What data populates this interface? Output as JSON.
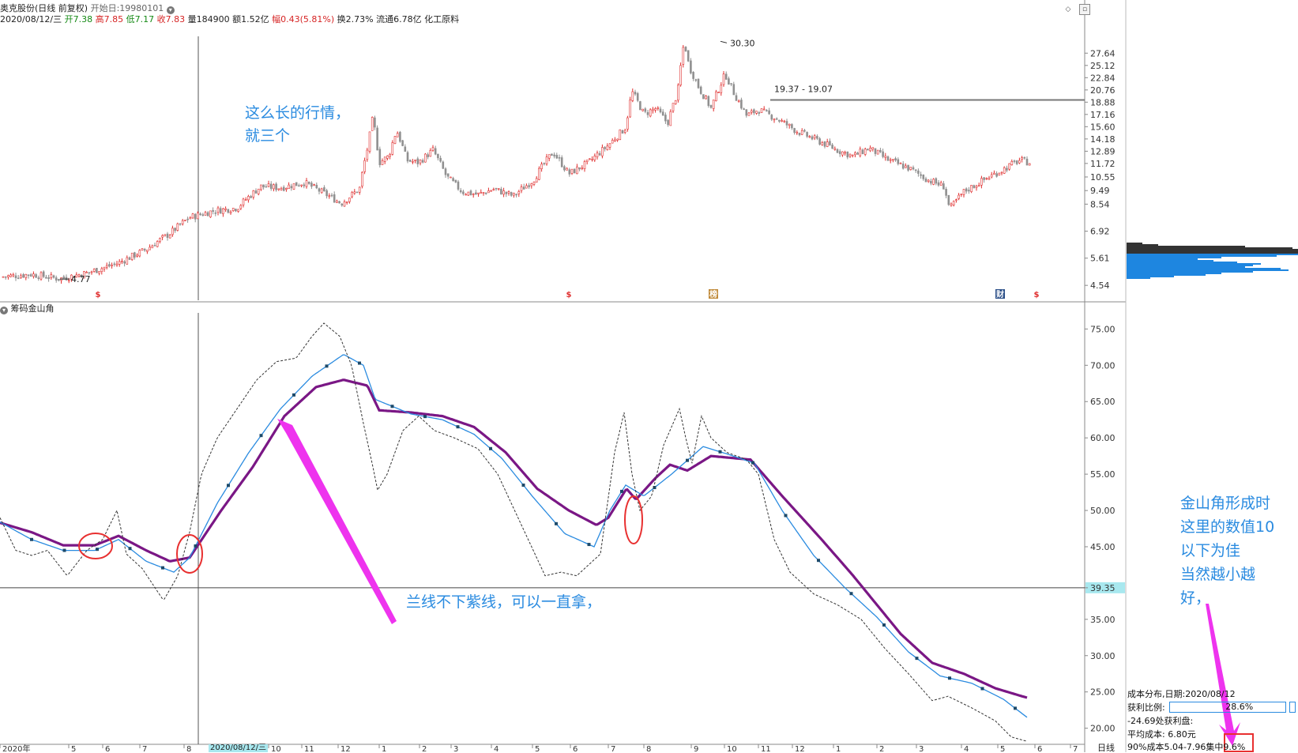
{
  "header": {
    "stock": "奥克股份(日线 前复权)",
    "start_label": "开始日:19980101",
    "line2": {
      "date": "2020/08/12/三",
      "open_label": "开",
      "open": "7.38",
      "high_label": "高",
      "high": "7.85",
      "low_label": "低",
      "low": "7.17",
      "close_label": "收",
      "close": "7.83",
      "vol": "量184900",
      "amount": "额1.52亿",
      "change_label": "幅",
      "change": "0.43(5.81%)",
      "turnover": "换2.73%",
      "float": "流通6.78亿",
      "industry": "化工原料"
    }
  },
  "indicator_label": "筹码金山角",
  "cursor_label": "2020/08/12/三",
  "period_label": "日线",
  "annotations": {
    "top_note": [
      "这么长的行情，",
      "就三个"
    ],
    "mid_note": "兰线不下紫线，可以一直拿，",
    "right_note": [
      "金山角形成时",
      "这里的数值10",
      "以下为佳",
      "当然越小越",
      "好，"
    ]
  },
  "cost_panel": {
    "title": "成本分布,日期:",
    "date": "2020/08/12",
    "profit_label": "获利比例:",
    "profit_value": "28.6%",
    "line3": "-24.69处获利盘:",
    "avg_label": "平均成本:",
    "avg_value": "6.80元",
    "conc_label": "90%成本5.04-7.96集中",
    "conc_value": "9.6%"
  },
  "colors": {
    "up": "#e03030",
    "down": "#909090",
    "blue": "#2a8be0",
    "purple": "#7a1785",
    "magenta": "#ee33ee",
    "circle": "#e83030",
    "dist_blue": "#1e86e0",
    "dist_dark": "#333333"
  },
  "chart_data": [
    {
      "type": "candlestick",
      "y_ticks": [
        "27.64",
        "25.12",
        "22.84",
        "20.76",
        "18.88",
        "17.16",
        "15.60",
        "14.18",
        "12.89",
        "11.72",
        "10.55",
        "9.49",
        "8.54",
        "6.92",
        "5.61",
        "4.54"
      ],
      "ylim": [
        4.3,
        31.5
      ],
      "log_scale": true,
      "x_ticks": [
        "2020年",
        "5",
        "6",
        "7",
        "8",
        "2020/08/12/三",
        "10",
        "11",
        "12",
        "1",
        "2",
        "3",
        "4",
        "5",
        "6",
        "7",
        "8",
        "9",
        "10",
        "11",
        "12",
        "1",
        "2",
        "3",
        "4",
        "5",
        "6",
        "7"
      ],
      "anchors": [
        [
          0,
          4.85
        ],
        [
          40,
          4.95
        ],
        [
          75,
          4.78
        ],
        [
          110,
          5.0
        ],
        [
          150,
          5.4
        ],
        [
          185,
          6.0
        ],
        [
          215,
          6.8
        ],
        [
          240,
          7.7
        ],
        [
          270,
          8.1
        ],
        [
          300,
          8.3
        ],
        [
          330,
          9.8
        ],
        [
          355,
          9.7
        ],
        [
          385,
          10.1
        ],
        [
          410,
          9.3
        ],
        [
          432,
          8.6
        ],
        [
          455,
          9.6
        ],
        [
          466,
          13.5
        ],
        [
          472,
          16.8
        ],
        [
          480,
          11.8
        ],
        [
          492,
          12.4
        ],
        [
          502,
          15.2
        ],
        [
          515,
          12.0
        ],
        [
          530,
          11.8
        ],
        [
          548,
          13.0
        ],
        [
          565,
          10.6
        ],
        [
          585,
          9.4
        ],
        [
          605,
          9.2
        ],
        [
          625,
          9.6
        ],
        [
          650,
          9.1
        ],
        [
          675,
          10.3
        ],
        [
          700,
          12.8
        ],
        [
          720,
          10.8
        ],
        [
          745,
          11.8
        ],
        [
          770,
          13.5
        ],
        [
          792,
          15.5
        ],
        [
          800,
          20.5
        ],
        [
          815,
          17.2
        ],
        [
          830,
          18.0
        ],
        [
          845,
          16.0
        ],
        [
          858,
          20.5
        ],
        [
          866,
          30.3
        ],
        [
          872,
          25.0
        ],
        [
          885,
          21.0
        ],
        [
          900,
          18.0
        ],
        [
          918,
          23.5
        ],
        [
          930,
          20.0
        ],
        [
          945,
          17.0
        ],
        [
          960,
          17.8
        ],
        [
          985,
          16.5
        ],
        [
          1010,
          15.0
        ],
        [
          1035,
          14.0
        ],
        [
          1060,
          13.0
        ],
        [
          1080,
          12.4
        ],
        [
          1100,
          13.2
        ],
        [
          1125,
          12.0
        ],
        [
          1150,
          11.3
        ],
        [
          1175,
          10.3
        ],
        [
          1195,
          9.8
        ],
        [
          1202,
          8.2
        ],
        [
          1220,
          9.4
        ],
        [
          1245,
          10.3
        ],
        [
          1270,
          11.2
        ],
        [
          1290,
          12.0
        ],
        [
          1305,
          11.8
        ]
      ],
      "labels": [
        {
          "text": "30.30",
          "value": 30.3
        },
        {
          "text": "4.77",
          "value": 4.77
        },
        {
          "text": "19.37 - 19.07",
          "value": 19.2
        }
      ],
      "markers": [
        "$",
        "$",
        "榜",
        "财",
        "$"
      ],
      "extra_ticks": [
        {
          "text": "39.35",
          "value": 39.35
        }
      ]
    },
    {
      "type": "line",
      "name": "筹码金山角",
      "y_ticks": [
        "75.00",
        "70.00",
        "65.00",
        "60.00",
        "55.00",
        "50.00",
        "45.00",
        "39.35",
        "35.00",
        "30.00",
        "25.00",
        "20.00"
      ],
      "ylim": [
        18,
        77
      ],
      "reference_value": 39.35,
      "series": [
        {
          "color": "purple",
          "anchors": [
            [
              0,
              48.3
            ],
            [
              40,
              47
            ],
            [
              80,
              45.2
            ],
            [
              120,
              45.2
            ],
            [
              150,
              46.5
            ],
            [
              185,
              44.5
            ],
            [
              215,
              43
            ],
            [
              240,
              43.5
            ],
            [
              280,
              50
            ],
            [
              320,
              56
            ],
            [
              360,
              63
            ],
            [
              400,
              67
            ],
            [
              435,
              68
            ],
            [
              465,
              67.2
            ],
            [
              480,
              63.8
            ],
            [
              520,
              63.5
            ],
            [
              560,
              63
            ],
            [
              600,
              61.5
            ],
            [
              640,
              58
            ],
            [
              680,
              53
            ],
            [
              720,
              50
            ],
            [
              755,
              48
            ],
            [
              770,
              49
            ],
            [
              793,
              53
            ],
            [
              805,
              51.5
            ],
            [
              830,
              54.5
            ],
            [
              848,
              56.3
            ],
            [
              870,
              55.5
            ],
            [
              900,
              57.5
            ],
            [
              950,
              57
            ],
            [
              990,
              52
            ],
            [
              1040,
              46
            ],
            [
              1080,
              41
            ],
            [
              1110,
              37
            ],
            [
              1140,
              33
            ],
            [
              1180,
              29
            ],
            [
              1220,
              27.5
            ],
            [
              1260,
              25.5
            ],
            [
              1300,
              24.2
            ]
          ]
        },
        {
          "color": "blue",
          "anchors": [
            [
              0,
              48.4
            ],
            [
              40,
              46
            ],
            [
              80,
              44.5
            ],
            [
              120,
              44.5
            ],
            [
              150,
              46
            ],
            [
              185,
              43
            ],
            [
              220,
              41.5
            ],
            [
              240,
              43.5
            ],
            [
              275,
              51
            ],
            [
              315,
              58
            ],
            [
              355,
              64
            ],
            [
              395,
              68.5
            ],
            [
              435,
              71.5
            ],
            [
              460,
              70
            ],
            [
              475,
              65.3
            ],
            [
              520,
              63.3
            ],
            [
              560,
              62.5
            ],
            [
              600,
              60.5
            ],
            [
              635,
              57.2
            ],
            [
              675,
              51.8
            ],
            [
              715,
              46.8
            ],
            [
              752,
              45
            ],
            [
              772,
              50
            ],
            [
              792,
              53.5
            ],
            [
              815,
              52
            ],
            [
              850,
              55
            ],
            [
              890,
              58.8
            ],
            [
              920,
              57.8
            ],
            [
              955,
              56.5
            ],
            [
              990,
              50
            ],
            [
              1030,
              43.8
            ],
            [
              1070,
              39.3
            ],
            [
              1110,
              35.3
            ],
            [
              1150,
              30.5
            ],
            [
              1190,
              27.2
            ],
            [
              1230,
              26.2
            ],
            [
              1270,
              24
            ],
            [
              1300,
              21.5
            ]
          ]
        },
        {
          "color": "dashed",
          "anchors": [
            [
              0,
              49
            ],
            [
              20,
              44.5
            ],
            [
              40,
              43.8
            ],
            [
              60,
              44.5
            ],
            [
              85,
              41
            ],
            [
              110,
              44.5
            ],
            [
              130,
              46
            ],
            [
              148,
              50
            ],
            [
              160,
              44
            ],
            [
              180,
              42
            ],
            [
              207,
              37.6
            ],
            [
              225,
              41
            ],
            [
              240,
              47
            ],
            [
              255,
              55
            ],
            [
              275,
              60
            ],
            [
              300,
              64
            ],
            [
              325,
              68
            ],
            [
              350,
              70.5
            ],
            [
              375,
              71
            ],
            [
              395,
              74
            ],
            [
              410,
              75.8
            ],
            [
              430,
              74
            ],
            [
              445,
              70
            ],
            [
              460,
              62
            ],
            [
              472,
              56
            ],
            [
              478,
              52.8
            ],
            [
              490,
              55
            ],
            [
              510,
              61
            ],
            [
              530,
              63
            ],
            [
              550,
              61
            ],
            [
              575,
              60
            ],
            [
              605,
              58.5
            ],
            [
              630,
              55
            ],
            [
              660,
              48
            ],
            [
              690,
              41
            ],
            [
              710,
              41.5
            ],
            [
              730,
              41
            ],
            [
              760,
              44
            ],
            [
              778,
              58
            ],
            [
              790,
              63.5
            ],
            [
              800,
              55
            ],
            [
              810,
              50
            ],
            [
              825,
              52
            ],
            [
              840,
              59
            ],
            [
              860,
              64
            ],
            [
              868,
              60
            ],
            [
              876,
              56.5
            ],
            [
              888,
              63
            ],
            [
              900,
              60
            ],
            [
              920,
              58
            ],
            [
              945,
              57
            ],
            [
              960,
              55
            ],
            [
              980,
              46
            ],
            [
              1000,
              41.5
            ],
            [
              1030,
              38.5
            ],
            [
              1060,
              37
            ],
            [
              1090,
              35
            ],
            [
              1120,
              31
            ],
            [
              1150,
              27.5
            ],
            [
              1180,
              23.8
            ],
            [
              1200,
              24.4
            ],
            [
              1230,
              22.8
            ],
            [
              1260,
              21
            ],
            [
              1280,
              18.8
            ],
            [
              1300,
              18.2
            ]
          ]
        }
      ]
    },
    {
      "type": "bar",
      "name": "cost-distribution",
      "bins": [
        [
          307,
          20,
          "dark"
        ],
        [
          309,
          40,
          "dark"
        ],
        [
          311,
          150,
          "dark"
        ],
        [
          313,
          210,
          "dark"
        ],
        [
          315,
          250,
          "dark"
        ],
        [
          317,
          275,
          "dark"
        ],
        [
          319,
          260,
          "dark"
        ],
        [
          321,
          250,
          "blue"
        ],
        [
          323,
          190,
          "blue"
        ],
        [
          325,
          120,
          "blue"
        ],
        [
          327,
          90,
          "blue"
        ],
        [
          329,
          110,
          "blue"
        ],
        [
          331,
          140,
          "blue"
        ],
        [
          333,
          170,
          "blue"
        ],
        [
          335,
          160,
          "blue"
        ],
        [
          337,
          150,
          "blue"
        ],
        [
          339,
          195,
          "blue"
        ],
        [
          341,
          205,
          "blue"
        ],
        [
          343,
          160,
          "blue"
        ],
        [
          345,
          120,
          "blue"
        ],
        [
          347,
          100,
          "blue"
        ],
        [
          349,
          60,
          "blue"
        ],
        [
          351,
          30,
          "blue"
        ]
      ]
    }
  ]
}
